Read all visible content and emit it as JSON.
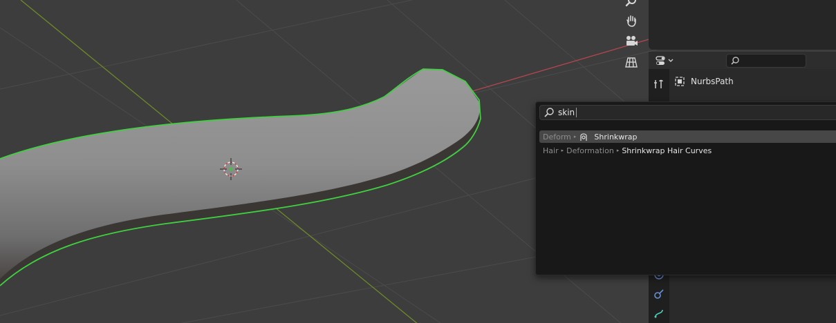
{
  "viewport": {
    "selection_outline_color": "#40d040",
    "x_axis_color": "#b4474e",
    "y_axis_color": "#6d8a29",
    "grid_color": "#4a4a4a",
    "background_color": "#3d3d3d"
  },
  "nav_tools": [
    "zoom-icon",
    "pan-hand-icon",
    "camera-icon",
    "grid-view-icon"
  ],
  "properties": {
    "object_name": "NurbsPath",
    "search_placeholder": ""
  },
  "search_popup": {
    "query": "skin",
    "results": [
      {
        "path": [
          "Deform"
        ],
        "icon": "shrinkwrap-icon",
        "label": "Shrinkwrap",
        "active": true
      },
      {
        "path": [
          "Hair",
          "Deformation"
        ],
        "icon": "",
        "label": "Shrinkwrap Hair Curves",
        "active": false
      }
    ]
  }
}
